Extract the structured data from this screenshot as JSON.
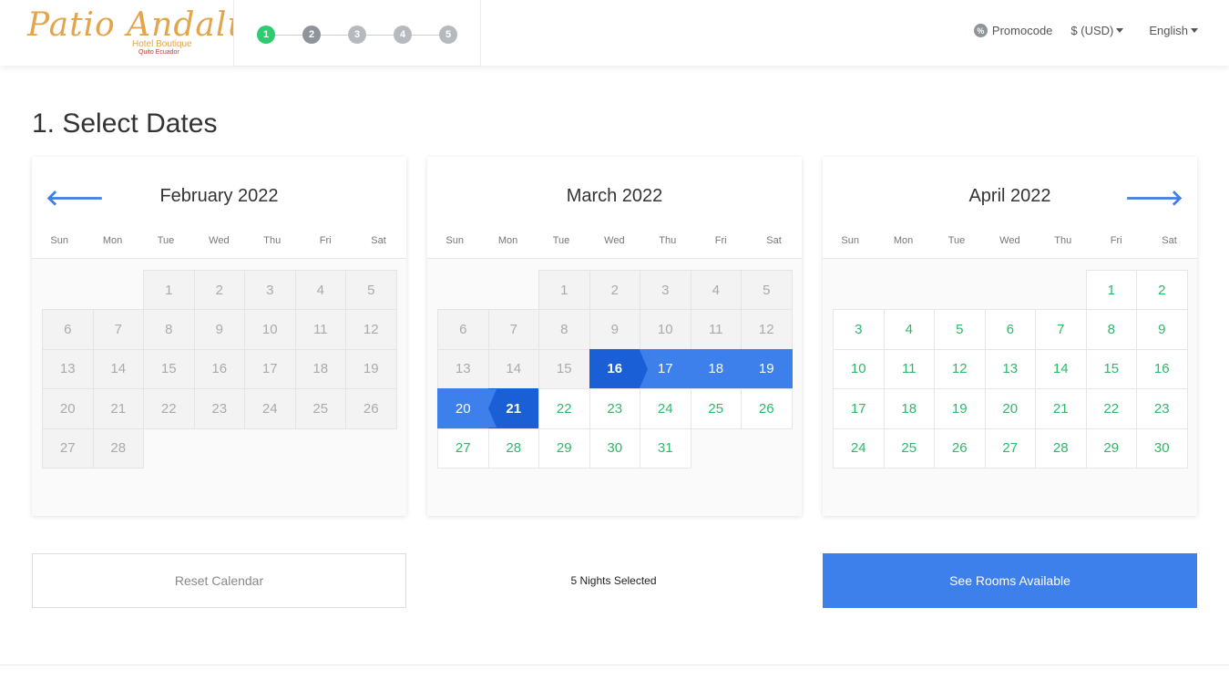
{
  "header": {
    "logo": {
      "script": "Patio Andaluz",
      "subtitle": "Hotel Boutique",
      "location": "Quito Ecuador"
    },
    "steps": [
      {
        "label": "1",
        "state": "active"
      },
      {
        "label": "2",
        "state": "mid"
      },
      {
        "label": "3",
        "state": "dim"
      },
      {
        "label": "4",
        "state": "dim"
      },
      {
        "label": "5",
        "state": "dim"
      }
    ],
    "promocode_label": "Promocode",
    "promocode_icon": "%",
    "currency_label": "$ (USD)",
    "language_label": "English"
  },
  "page_title": "1. Select Dates",
  "weekdays": [
    "Sun",
    "Mon",
    "Tue",
    "Wed",
    "Thu",
    "Fri",
    "Sat"
  ],
  "nav": {
    "prev_icon": "arrow-left-icon",
    "next_icon": "arrow-right-icon",
    "prev_glyph": "🡐",
    "next_glyph": "🡒"
  },
  "calendars": [
    {
      "month": "February 2022",
      "offset": 2,
      "days": 28,
      "past_until": 28,
      "selected": [],
      "range_start": null,
      "range_end": null
    },
    {
      "month": "March 2022",
      "offset": 2,
      "days": 31,
      "past_until": 15,
      "selected": [
        16,
        17,
        18,
        19,
        20,
        21
      ],
      "range_start": 16,
      "range_end": 21
    },
    {
      "month": "April 2022",
      "offset": 5,
      "days": 30,
      "past_until": 0,
      "selected": [],
      "range_start": null,
      "range_end": null
    }
  ],
  "actions": {
    "reset_label": "Reset Calendar",
    "nights_label": "5 Nights Selected",
    "see_rooms_label": "See Rooms Available"
  },
  "colors": {
    "accent": "#3d80ec",
    "accent_dark": "#1a5fd6",
    "available": "#2eb86a",
    "step_active": "#2ecc71",
    "logo": "#e3a44a"
  }
}
